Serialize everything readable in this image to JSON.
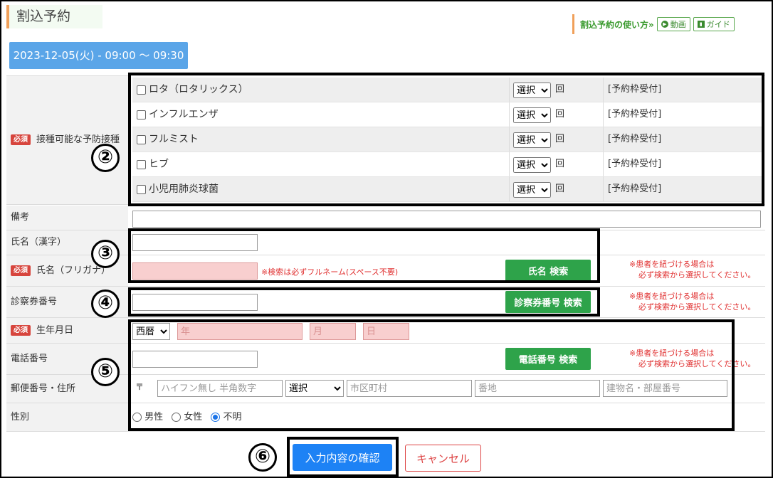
{
  "header": {
    "title": "割込予約",
    "help_link": "割込予約の使い方»",
    "video_label": "動画",
    "guide_label": "ガイド"
  },
  "slot": {
    "date_label": "2023-12-05(火) - 09:00 〜 09:30"
  },
  "vaccines": {
    "required_badge": "必須",
    "label": "接種可能な予防接種",
    "items": [
      {
        "name": "ロタ（ロタリックス）",
        "select": "選択",
        "unit": "回",
        "status": "[予約枠受付]"
      },
      {
        "name": "インフルエンザ",
        "select": "選択",
        "unit": "回",
        "status": "[予約枠受付]"
      },
      {
        "name": "フルミスト",
        "select": "選択",
        "unit": "回",
        "status": "[予約枠受付]"
      },
      {
        "name": "ヒブ",
        "select": "選択",
        "unit": "回",
        "status": "[予約枠受付]"
      },
      {
        "name": "小児用肺炎球菌",
        "select": "選択",
        "unit": "回",
        "status": "[予約枠受付]"
      }
    ]
  },
  "form": {
    "remarks_label": "備考",
    "kanji_name_label": "氏名（漢字）",
    "kana_name_label": "氏名（フリガナ）",
    "kana_hint": "※検索は必ずフルネーム(スペース不要)",
    "name_search_button": "氏名 検索",
    "link_note_line1": "※患者を紐づける場合は",
    "link_note_line2": "必ず検索から選択してください。",
    "card_number_label": "診察券番号",
    "card_search_button": "診察券番号 検索",
    "birthdate_label": "生年月日",
    "era_select": "西暦",
    "year_placeholder": "年",
    "month_placeholder": "月",
    "day_placeholder": "日",
    "phone_label": "電話番号",
    "phone_search_button": "電話番号 検索",
    "address_label": "郵便番号・住所",
    "postal_mark": "〒",
    "postal_placeholder": "ハイフン無し 半角数字",
    "prefecture_select": "選択",
    "city_placeholder": "市区町村",
    "street_placeholder": "番地",
    "building_placeholder": "建物名・部屋番号",
    "gender_label": "性別",
    "gender_options": [
      "男性",
      "女性",
      "不明"
    ],
    "gender_selected": "不明"
  },
  "actions": {
    "confirm_button": "入力内容の確認",
    "cancel_button": "キャンセル"
  },
  "annotations": {
    "marker_2": "②",
    "marker_3": "③",
    "marker_4": "④",
    "marker_5": "⑤",
    "marker_6": "⑥"
  }
}
